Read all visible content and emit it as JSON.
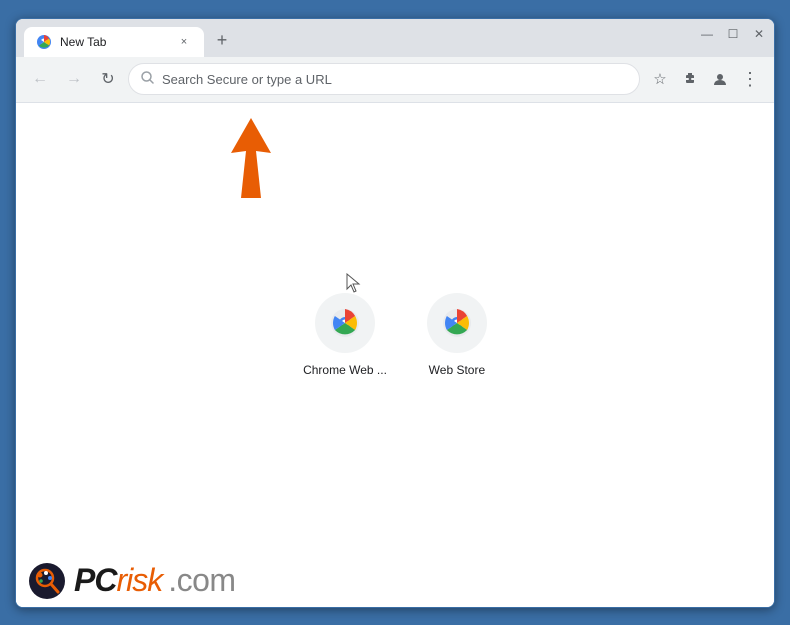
{
  "browser": {
    "tab": {
      "title": "New Tab",
      "close_label": "×"
    },
    "new_tab_btn": "+",
    "window_controls": {
      "minimize": "—",
      "maximize": "☐",
      "close": "✕"
    },
    "toolbar": {
      "back_arrow": "←",
      "forward_arrow": "→",
      "refresh": "↻",
      "search_placeholder": "Search Secure or type a URL",
      "bookmark_icon": "☆",
      "extensions_icon": "🧩",
      "profile_icon": "👤",
      "menu_icon": "⋮"
    }
  },
  "shortcuts": [
    {
      "label": "Chrome Web ...",
      "id": "chrome-web"
    },
    {
      "label": "Web Store",
      "id": "web-store"
    }
  ],
  "watermark": {
    "text_bold": "PC",
    "text_accent": "risk",
    "text_domain": ".com"
  }
}
